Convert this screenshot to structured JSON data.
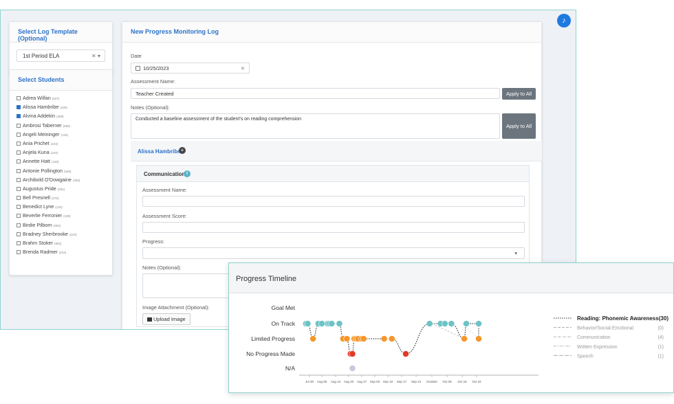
{
  "template_panel": {
    "title": "Select Log Template (Optional)",
    "selected": "1st Period ELA",
    "clear_icon": "close-icon",
    "dropdown_icon": "chevron-down-icon"
  },
  "students_panel": {
    "title": "Select Students",
    "students": [
      {
        "name": "Adrea Willan",
        "num": "(537)",
        "checked": false
      },
      {
        "name": "Alissa Hambribe",
        "num": "(426)",
        "checked": true
      },
      {
        "name": "Alvina Addekin",
        "num": "(388)",
        "checked": true
      },
      {
        "name": "Ambrosi Taberner",
        "num": "(595)",
        "checked": false
      },
      {
        "name": "Angeli Meininger",
        "num": "(134)",
        "checked": false
      },
      {
        "name": "Ania Prichet",
        "num": "(103)",
        "checked": false
      },
      {
        "name": "Anjela Kuna",
        "num": "(104)",
        "checked": false
      },
      {
        "name": "Annette Hatt",
        "num": "(420)",
        "checked": false
      },
      {
        "name": "Antonie Pollington",
        "num": "(548)",
        "checked": false
      },
      {
        "name": "Archibold O'Dowgaine",
        "num": "(258)",
        "checked": false
      },
      {
        "name": "Augustus Pride",
        "num": "(281)",
        "checked": false
      },
      {
        "name": "Bell Presnell",
        "num": "(375)",
        "checked": false
      },
      {
        "name": "Benedict Lyne",
        "num": "(133)",
        "checked": false
      },
      {
        "name": "Beverlie Ferronier",
        "num": "(108)",
        "checked": false
      },
      {
        "name": "Birdie Pilborn",
        "num": "(994)",
        "checked": false
      },
      {
        "name": "Bradney Sherbrooke",
        "num": "(223)",
        "checked": false
      },
      {
        "name": "Brahm Stoker",
        "num": "(862)",
        "checked": false
      },
      {
        "name": "Brenda Radmer",
        "num": "(224)",
        "checked": false
      }
    ]
  },
  "log_form": {
    "title": "New Progress Monitoring Log",
    "date_label": "Date",
    "date_value": "10/25/2023",
    "calendar_icon": "calendar-icon",
    "assessment_name_label": "Assessment Name:",
    "assessment_name_value": "Teacher Created",
    "apply_label": "Apply to All",
    "notes_label": "Notes (Optional):",
    "notes_value": "Conducted a baseline assessment of the student's on reading comprehension"
  },
  "student_section": {
    "name": "Alissa Hambribe",
    "goal_area": "Communication",
    "assessment_name_label": "Assessment Name:",
    "assessment_score_label": "Assessment Score:",
    "progress_label": "Progress:",
    "notes_label": "Notes (Optional):",
    "image_label": "Image Attachment (Optional):",
    "upload_label": "Upload Image"
  },
  "timeline": {
    "title": "Progress Timeline",
    "colors": {
      "on_track": "#6cc3c6",
      "limited": "#f5962a",
      "no_progress": "#e23a28",
      "na": "#c8c8dc",
      "line": "#444444"
    },
    "chart_data": {
      "type": "scatter",
      "y_categories": [
        "Goal Met",
        "On Track",
        "Limited Progress",
        "No Progress Made",
        "N/A"
      ],
      "x_ticks": [
        "Jul 30",
        "Aug 06",
        "Aug 13",
        "Aug 20",
        "Aug 27",
        "Sep 03",
        "Sep 10",
        "Sep 17",
        "Sep 24",
        "October",
        "Oct 08",
        "Oct 15",
        "Oct 22"
      ],
      "series": [
        {
          "name": "Reading: Phonemic Awareness",
          "count": "(30)",
          "line_style": "dotted",
          "highlight": true
        },
        {
          "name": "Behavior/Social-Emotional",
          "count": "(0)",
          "line_style": "dashed",
          "highlight": false
        },
        {
          "name": "Communication",
          "count": "(4)",
          "line_style": "dash-dot",
          "highlight": false
        },
        {
          "name": "Written Expression",
          "count": "(1)",
          "line_style": "dash-dot-dot",
          "highlight": false
        },
        {
          "name": "Speech",
          "count": "(1)",
          "line_style": "long-dash",
          "highlight": false
        }
      ],
      "points": [
        {
          "x": "Jul 28",
          "y": "On Track"
        },
        {
          "x": "Jul 29",
          "y": "On Track"
        },
        {
          "x": "Aug 01",
          "y": "Limited Progress"
        },
        {
          "x": "Aug 04",
          "y": "On Track"
        },
        {
          "x": "Aug 06",
          "y": "On Track"
        },
        {
          "x": "Aug 09",
          "y": "On Track"
        },
        {
          "x": "Aug 10",
          "y": "On Track"
        },
        {
          "x": "Aug 11",
          "y": "On Track"
        },
        {
          "x": "Aug 15",
          "y": "On Track"
        },
        {
          "x": "Aug 17",
          "y": "Limited Progress"
        },
        {
          "x": "Aug 19",
          "y": "Limited Progress"
        },
        {
          "x": "Aug 21",
          "y": "No Progress Made"
        },
        {
          "x": "Aug 22",
          "y": "No Progress Made"
        },
        {
          "x": "Aug 22",
          "y": "N/A"
        },
        {
          "x": "Aug 23",
          "y": "Limited Progress"
        },
        {
          "x": "Aug 24",
          "y": "Limited Progress"
        },
        {
          "x": "Aug 25",
          "y": "Limited Progress"
        },
        {
          "x": "Aug 27",
          "y": "Limited Progress"
        },
        {
          "x": "Aug 28",
          "y": "Limited Progress"
        },
        {
          "x": "Sep 08",
          "y": "Limited Progress"
        },
        {
          "x": "Sep 12",
          "y": "Limited Progress"
        },
        {
          "x": "Sep 19",
          "y": "No Progress Made"
        },
        {
          "x": "Sep 30",
          "y": "On Track"
        },
        {
          "x": "Oct 05",
          "y": "On Track"
        },
        {
          "x": "Oct 07",
          "y": "On Track"
        },
        {
          "x": "Oct 10",
          "y": "On Track"
        },
        {
          "x": "Oct 16",
          "y": "Limited Progress"
        },
        {
          "x": "Oct 17",
          "y": "On Track"
        },
        {
          "x": "Oct 23",
          "y": "On Track"
        },
        {
          "x": "Oct 23",
          "y": "Limited Progress"
        }
      ]
    }
  },
  "icons": {
    "notification": "bell-icon",
    "info": "info-icon",
    "add": "plus-circle-icon",
    "upload": "image-icon"
  }
}
